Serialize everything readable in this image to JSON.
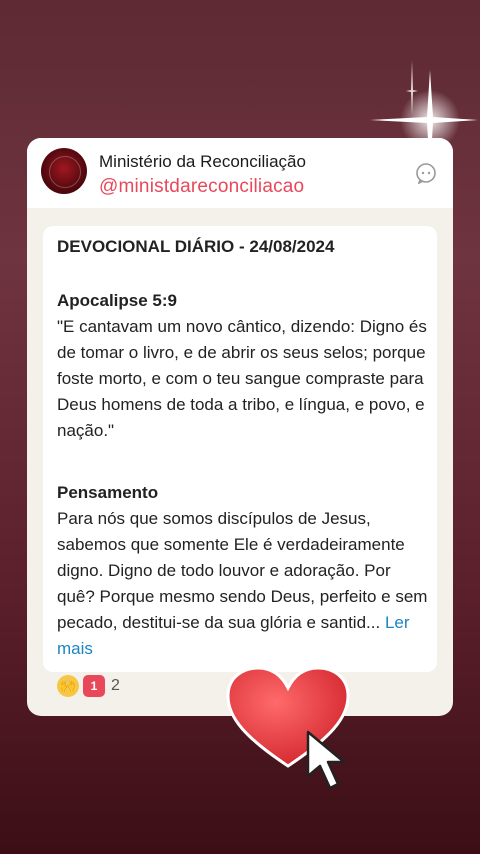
{
  "channel": {
    "name": "Ministério da Reconciliação",
    "handle": "@ministdareconciliacao"
  },
  "post": {
    "title": "DEVOCIONAL DIÁRIO - 24/08/2024",
    "reference": "Apocalipse 5:9",
    "verse": "\"E cantavam um novo cântico, dizendo: Digno és de tomar o livro, e de abrir os seus selos; porque foste morto, e com o teu sangue compraste para Deus homens de toda a tribo, e língua, e povo, e nação.\"",
    "section_title": "Pensamento",
    "body": "Para nós que somos discípulos de Jesus, sabemos que somente Ele é verdadeiramente digno. Digno de todo louvor e adoração. Por quê? Porque mesmo sendo Deus, perfeito e sem pecado, destitui-se da sua glória e santid...",
    "read_more": "Ler mais"
  },
  "reactions": {
    "emoji_1": "🙌",
    "emoji_2": "1",
    "count": "2"
  },
  "icons": {
    "share": "share-icon",
    "heart": "heart-sticker-icon",
    "cursor": "pointer-cursor-icon"
  },
  "colors": {
    "handle": "#e8485a",
    "link": "#1a86c2",
    "heart": "#e0353b"
  }
}
